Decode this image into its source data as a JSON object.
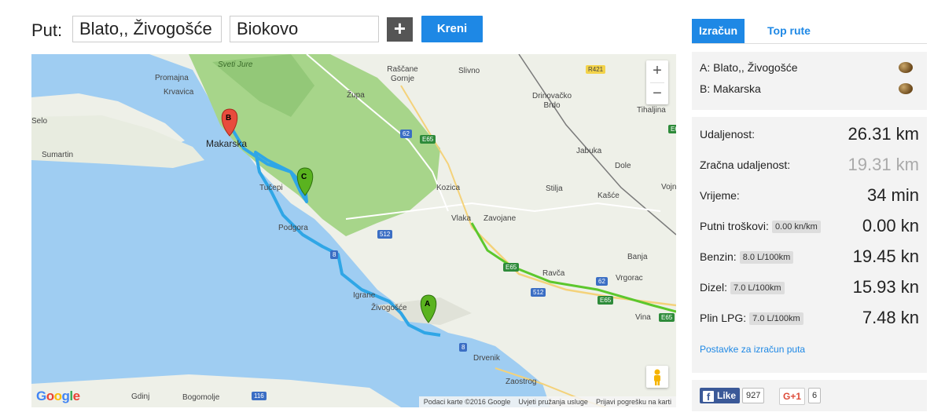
{
  "search": {
    "label": "Put:",
    "from_value": "Blato,, Živogošće",
    "to_value": "Biokovo",
    "add_label": "+",
    "go_label": "Kreni"
  },
  "map": {
    "zoom_in": "+",
    "zoom_out": "−",
    "logo": "Google",
    "footer": {
      "data": "Podaci karte ©2016 Google",
      "terms": "Uvjeti pružanja usluge",
      "report": "Prijavi pogrešku na karti"
    },
    "markers": {
      "a": "A",
      "b": "B",
      "c": "C"
    },
    "labels": {
      "sveti_jure": "Sveti Jure",
      "promajna": "Promajna",
      "krvavica": "Krvavica",
      "selo": "Selo",
      "sumartin": "Sumartin",
      "makarska": "Makarska",
      "tucepi": "Tučepi",
      "podgora": "Podgora",
      "igrane": "Igrane",
      "zivogosce": "Živogošće",
      "drvenik": "Drvenik",
      "zaostrog": "Zaostrog",
      "gdinj": "Gdinj",
      "bogomolje": "Bogomolje",
      "zupa": "Župa",
      "rascane": "Raščane Gornje",
      "slivno": "Slivno",
      "drinovacko": "Drinovačko Brdo",
      "tihaljina": "Tihaljina",
      "jabuka": "Jabuka",
      "dole": "Dole",
      "kozica": "Kozica",
      "stilja": "Stilja",
      "kasce": "Kašće",
      "vojn": "Vojn",
      "vlaka": "Vlaka",
      "zavojane": "Zavojane",
      "banja": "Banja",
      "ravca": "Ravča",
      "vrgorac": "Vrgorac",
      "vina": "Vina"
    },
    "shields": {
      "r421": "R421",
      "s62a": "62",
      "e65a": "E65",
      "s512a": "512",
      "e65b": "E65",
      "s62b": "62",
      "s512b": "512",
      "e65c": "E65",
      "e65d": "E65",
      "s8a": "8",
      "s8b": "8",
      "s116": "116",
      "e65e": "E65"
    }
  },
  "tabs": [
    {
      "label": "Izračun",
      "active": true
    },
    {
      "label": "Top rute",
      "active": false
    }
  ],
  "waypoints": [
    {
      "label": "A: Blato,, Živogošće"
    },
    {
      "label": "B: Makarska"
    }
  ],
  "stats": [
    {
      "label": "Udaljenost:",
      "badge": "",
      "value": "26.31 km"
    },
    {
      "label": "Zračna udaljenost:",
      "badge": "",
      "value": "19.31 km"
    },
    {
      "label": "Vrijeme:",
      "badge": "",
      "value": "34 min"
    },
    {
      "label": "Putni troškovi:",
      "badge": "0.00 kn/km",
      "value": "0.00 kn"
    },
    {
      "label": "Benzin:",
      "badge": "8.0 L/100km",
      "value": "19.45 kn"
    },
    {
      "label": "Dizel:",
      "badge": "7.0 L/100km",
      "value": "15.93 kn"
    },
    {
      "label": "Plin LPG:",
      "badge": "7.0 L/100km",
      "value": "7.48 kn"
    }
  ],
  "settings_link": "Postavke za izračun puta",
  "social": {
    "fb_label": "Like",
    "fb_count": "927",
    "gplus_label": "G+1",
    "gplus_count": "6"
  },
  "colors": {
    "accent": "#1e88e5",
    "route": "#2fa6e6",
    "sea": "#9fcdf2",
    "park": "#a7d58a",
    "highway": "#5cc72d"
  }
}
